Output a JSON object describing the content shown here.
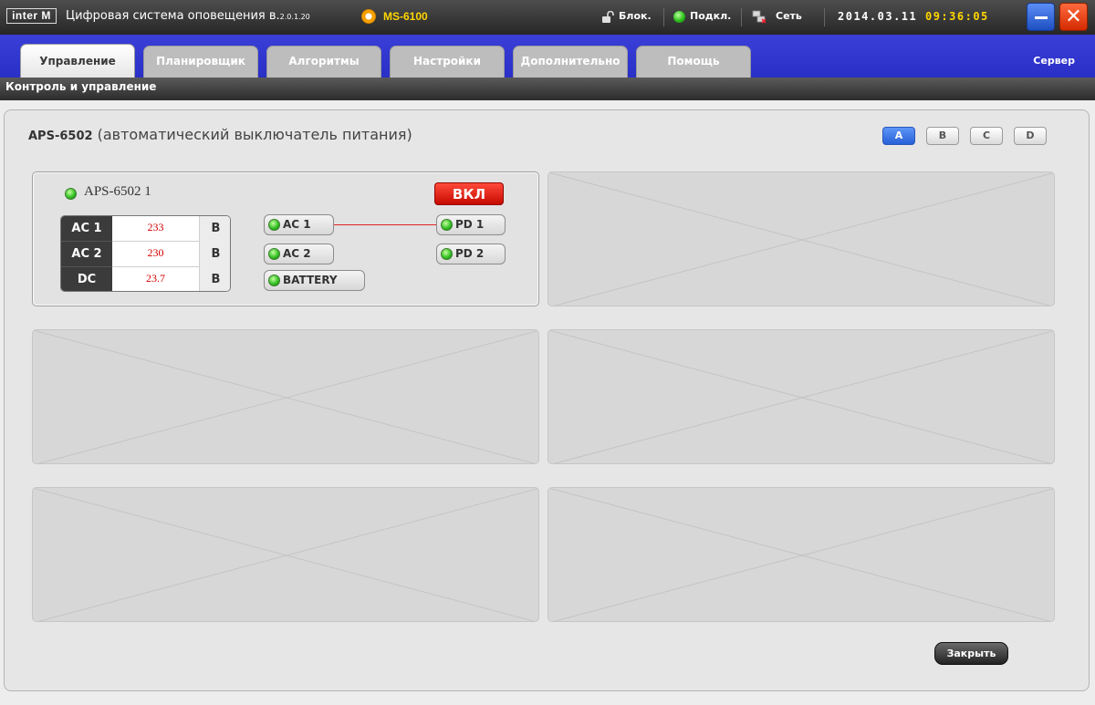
{
  "titlebar": {
    "logo": "inter M",
    "title": "Цифровая система оповещения в.",
    "version": "2.0.1.20",
    "device": "MS-6100",
    "lock_label": "Блок.",
    "connect_label": "Подкл.",
    "network_label": "Сеть",
    "date": "2014.03.11",
    "time": "09:36:05"
  },
  "tabs": [
    {
      "label": "Управление",
      "active": true
    },
    {
      "label": "Планировщик"
    },
    {
      "label": "Алгоритмы"
    },
    {
      "label": "Настройки"
    },
    {
      "label": "Дополнительно"
    },
    {
      "label": "Помощь"
    }
  ],
  "server_label": "Сервер",
  "subtitle": "Контроль и управление",
  "panel": {
    "model": "APS-6502",
    "description": " (автоматический выключатель питания)",
    "pages": [
      "A",
      "B",
      "C",
      "D"
    ],
    "active_page": "A"
  },
  "unit": {
    "name": "APS-6502 1",
    "state_button": "ВКЛ",
    "readings": [
      {
        "label": "AC 1",
        "value": "233",
        "unit": "B"
      },
      {
        "label": "AC 2",
        "value": "230",
        "unit": "B"
      },
      {
        "label": "DC",
        "value": "23.7",
        "unit": "B"
      }
    ],
    "inputs": [
      "AC 1",
      "AC 2",
      "BATTERY"
    ],
    "outputs": [
      "PD 1",
      "PD 2"
    ]
  },
  "close_button": "Закрыть",
  "colors": {
    "tabbar": "#2f34cc",
    "accent_red": "#d40000",
    "time_yellow": "#ffd600"
  }
}
